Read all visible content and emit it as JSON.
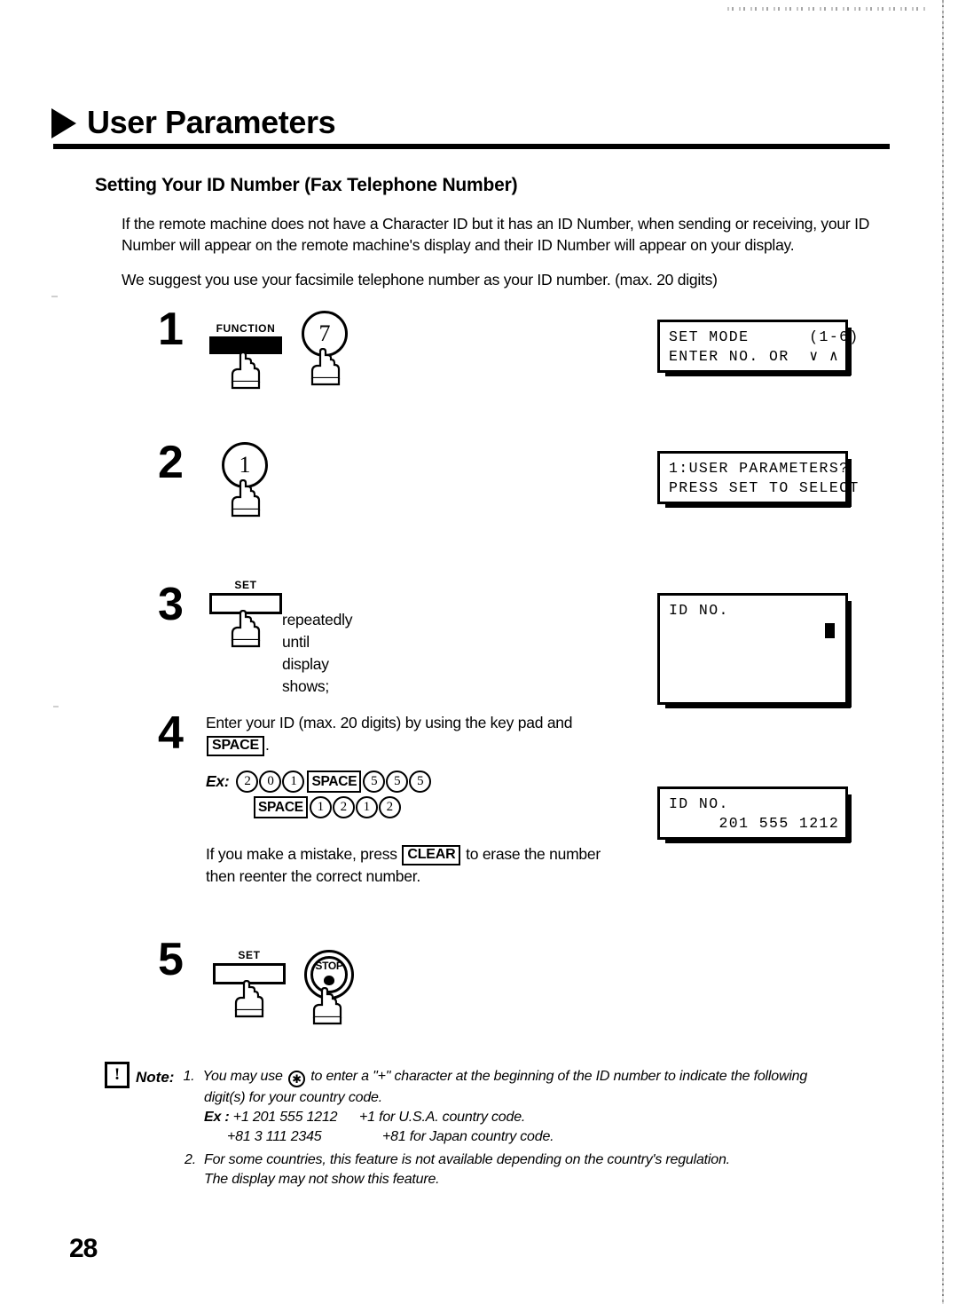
{
  "page": {
    "title": "User Parameters",
    "section_heading": "Setting Your ID Number (Fax Telephone Number)",
    "page_number": "28",
    "intro_paragraph_1": "If the remote machine does not have a Character ID but it has an ID Number, when sending or receiving, your ID Number will appear on the remote machine's display and their ID Number will appear on your display.",
    "intro_paragraph_2": "We suggest you use your facsimile telephone number as your ID number. (max. 20 digits)"
  },
  "steps": {
    "step1": {
      "number": "1",
      "function_key_label": "FUNCTION",
      "numeric_key_label": "7",
      "display_line_1": "SET MODE      (1-6)",
      "display_line_2": "ENTER NO. OR  ∨ ∧"
    },
    "step2": {
      "number": "2",
      "numeric_key_label": "1",
      "display_line_1": "1:USER PARAMETERS?",
      "display_line_2": "PRESS SET TO SELECT"
    },
    "step3": {
      "number": "3",
      "set_key_label": "SET",
      "instruction": "repeatedly until display shows;",
      "display_line_1": "ID NO.",
      "display_line_2": ""
    },
    "step4": {
      "number": "4",
      "instruction_part_1": "Enter your ID (max. 20 digits) by using the key pad and",
      "space_key_label": "SPACE",
      "instruction_part_2": ".",
      "ex_label": "Ex:",
      "ex_row_1": [
        "2",
        "0",
        "1",
        "SPACE",
        "5",
        "5",
        "5"
      ],
      "ex_row_2": [
        "SPACE",
        "1",
        "2",
        "1",
        "2"
      ],
      "mistake_text_part_1": "If you make a mistake, press",
      "clear_key_label": "CLEAR",
      "mistake_text_part_2": "to erase the number",
      "mistake_text_line_2": "then reenter the correct number.",
      "display_line_1": "ID NO.",
      "display_line_2": "     201 555 1212"
    },
    "step5": {
      "number": "5",
      "set_key_label": "SET",
      "stop_key_label": "STOP"
    }
  },
  "note": {
    "icon_glyph": "!",
    "label": "Note:",
    "item_1_marker": "1.",
    "item_1_text_part_1": "You may use",
    "item_1_asterisk": "✱",
    "item_1_text_part_2": "to enter a \"+\" character at the beginning of the ID number to indicate the following",
    "item_1_text_line_2": "digit(s) for your country code.",
    "item_1_ex_label": "Ex :",
    "item_1_ex_row_1_number": "+1 201 555 1212",
    "item_1_ex_row_1_desc": "+1 for U.S.A. country code.",
    "item_1_ex_row_2_number": "+81 3 111 2345",
    "item_1_ex_row_2_desc": "+81 for Japan country code.",
    "item_2_marker": "2.",
    "item_2_text_line_1": "For some countries, this feature is not available depending on the country's regulation.",
    "item_2_text_line_2": "The display may not show this feature."
  }
}
